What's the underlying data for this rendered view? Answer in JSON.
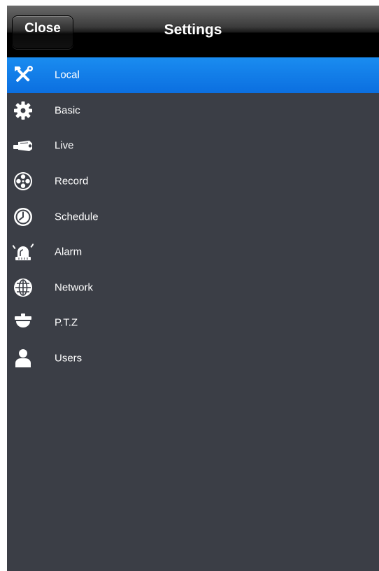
{
  "navbar": {
    "title": "Settings",
    "close_label": "Close"
  },
  "menu": {
    "items": [
      {
        "label": "Local",
        "icon": "tools-icon",
        "selected": true
      },
      {
        "label": "Basic",
        "icon": "gear-icon",
        "selected": false
      },
      {
        "label": "Live",
        "icon": "camera-icon",
        "selected": false
      },
      {
        "label": "Record",
        "icon": "film-reel-icon",
        "selected": false
      },
      {
        "label": "Schedule",
        "icon": "clock-icon",
        "selected": false
      },
      {
        "label": "Alarm",
        "icon": "siren-icon",
        "selected": false
      },
      {
        "label": "Network",
        "icon": "globe-icon",
        "selected": false
      },
      {
        "label": "P.T.Z",
        "icon": "dome-camera-icon",
        "selected": false
      },
      {
        "label": "Users",
        "icon": "user-icon",
        "selected": false
      }
    ]
  },
  "colors": {
    "background": "#3b3e46",
    "selected": "#1a7fe8",
    "navbar": "#000000",
    "text": "#ffffff"
  }
}
